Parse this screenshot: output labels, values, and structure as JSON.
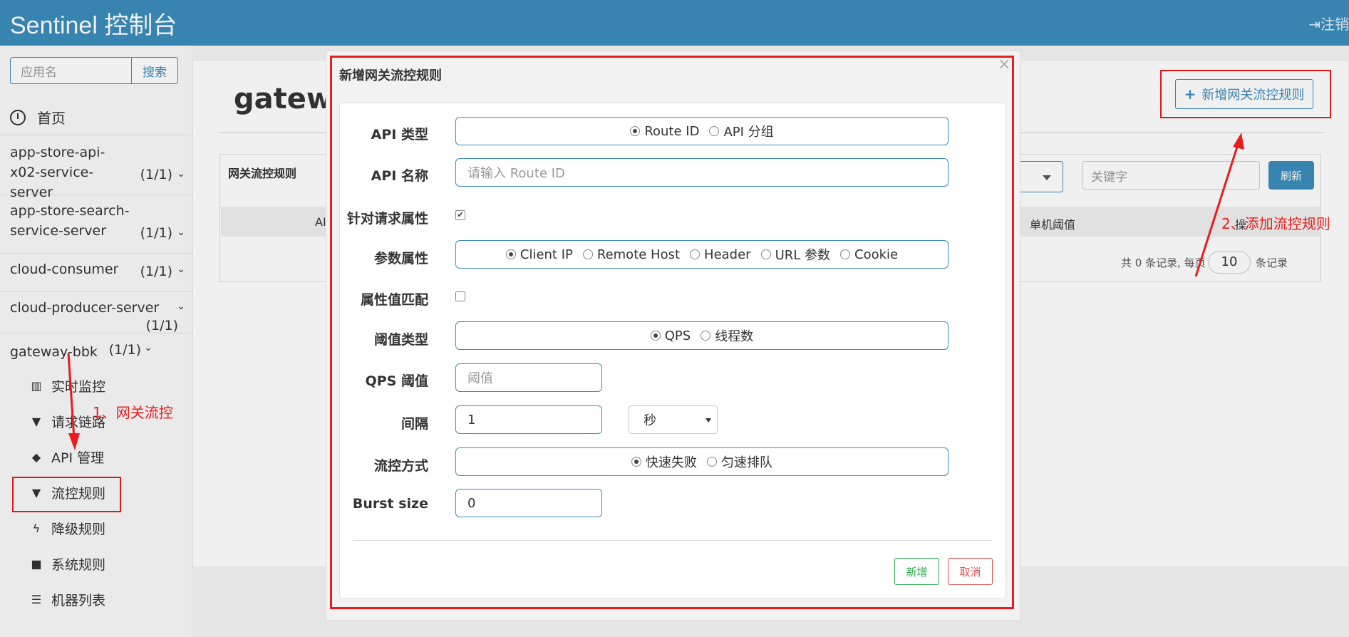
{
  "header": {
    "title": "Sentinel 控制台",
    "logout": "注销"
  },
  "sidebar": {
    "search_placeholder": "应用名",
    "search_button": "搜索",
    "home": "首页",
    "apps": [
      {
        "name": "app-store-api-x02-service-server",
        "count": "(1/1)"
      },
      {
        "name": "app-store-search-service-server",
        "count": "(1/1)"
      },
      {
        "name": "cloud-consumer",
        "count": "(1/1)"
      },
      {
        "name": "cloud-producer-server",
        "count": "(1/1)"
      },
      {
        "name": "gateway-bbk",
        "count": "(1/1)"
      }
    ],
    "sub_items": [
      {
        "label": "实时监控",
        "icon": "bar-chart-icon"
      },
      {
        "label": "请求链路",
        "icon": "filter-icon"
      },
      {
        "label": "API 管理",
        "icon": "tags-icon"
      },
      {
        "label": "流控规则",
        "icon": "filter-icon"
      },
      {
        "label": "降级规则",
        "icon": "bolt-icon"
      },
      {
        "label": "系统规则",
        "icon": "lock-icon"
      },
      {
        "label": "机器列表",
        "icon": "list-icon"
      }
    ]
  },
  "main": {
    "title": "gatewa",
    "add_rule_button": "新增网关流控规则",
    "panel_title": "网关流控规则",
    "keyword_placeholder": "关键字",
    "refresh_button": "刷新",
    "columns": {
      "api": "AI",
      "single_threshold": "单机阈值",
      "op": "操"
    },
    "pager": {
      "prefix": "共 0 条记录, 每页",
      "page_size": "10",
      "suffix": "条记录"
    }
  },
  "modal": {
    "title": "新增网关流控规则",
    "close": "×",
    "api_type": {
      "label": "API 类型",
      "options": [
        "Route ID",
        "API 分组"
      ],
      "selected": "Route ID"
    },
    "api_name": {
      "label": "API 名称",
      "placeholder": "请输入 Route ID"
    },
    "request_attr": {
      "label": "针对请求属性",
      "checked": true
    },
    "param_attr": {
      "label": "参数属性",
      "options": [
        "Client IP",
        "Remote Host",
        "Header",
        "URL 参数",
        "Cookie"
      ],
      "selected": "Client IP"
    },
    "attr_match": {
      "label": "属性值匹配",
      "checked": false
    },
    "threshold_type": {
      "label": "阈值类型",
      "options": [
        "QPS",
        "线程数"
      ],
      "selected": "QPS"
    },
    "qps_threshold": {
      "label": "QPS 阈值",
      "placeholder": "阈值"
    },
    "interval": {
      "label": "间隔",
      "value": "1",
      "unit": "秒"
    },
    "control_behavior": {
      "label": "流控方式",
      "options": [
        "快速失败",
        "匀速排队"
      ],
      "selected": "快速失败"
    },
    "burst": {
      "label": "Burst size",
      "value": "0"
    },
    "add_button": "新增",
    "cancel_button": "取消"
  },
  "annotations": {
    "step1": "1、网关流控",
    "step2": "2、添加流控规则",
    "color": "#e81d1d"
  }
}
